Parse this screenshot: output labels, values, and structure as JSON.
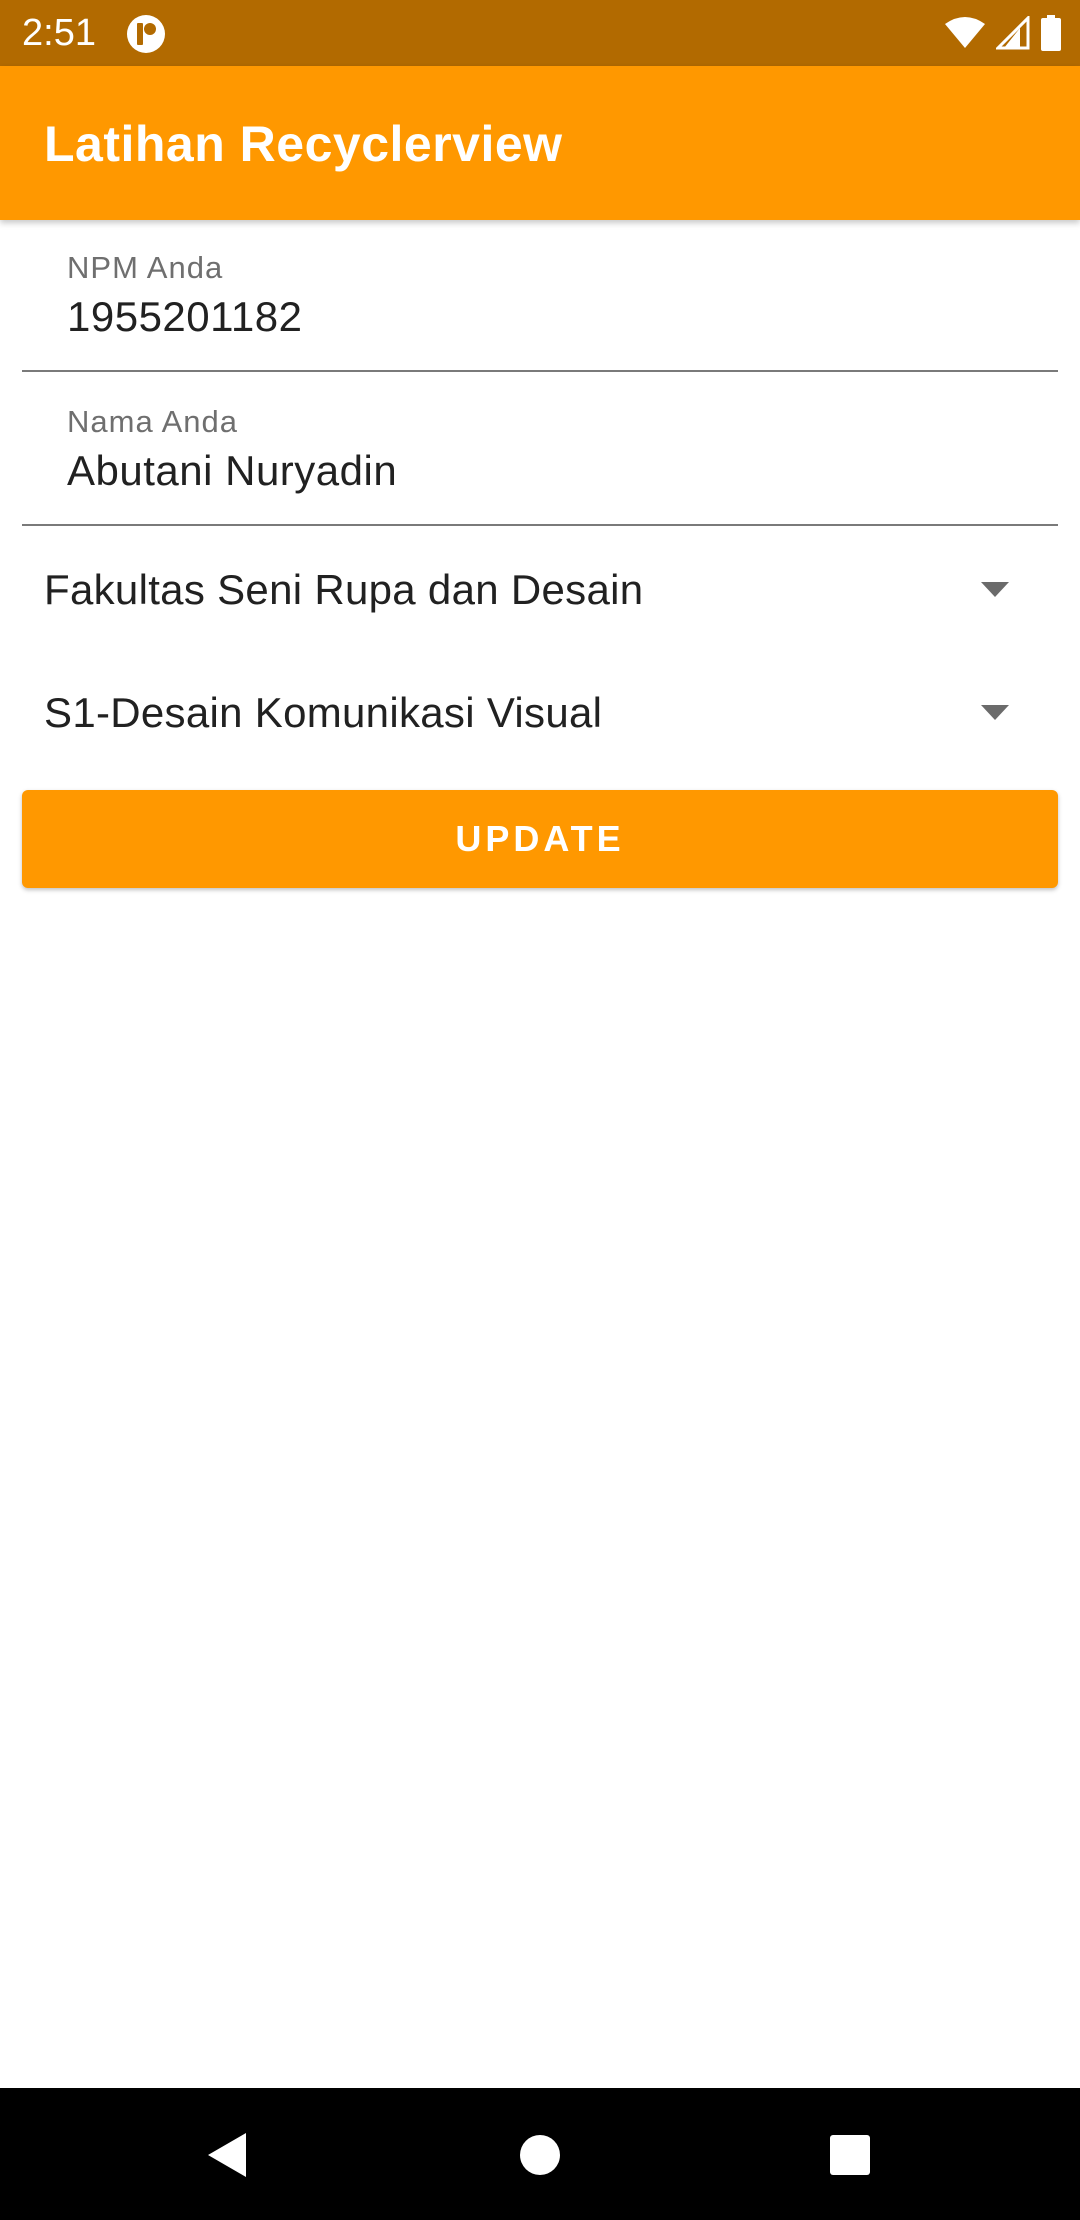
{
  "status_bar": {
    "time": "2:51",
    "icons": [
      "app-notification-icon",
      "wifi-icon",
      "signal-icon",
      "battery-icon"
    ],
    "background": "#b26a00"
  },
  "app_bar": {
    "title": "Latihan Recyclerview",
    "background": "#ff9800"
  },
  "form": {
    "npm": {
      "label": "NPM Anda",
      "value": "1955201182"
    },
    "nama": {
      "label": "Nama Anda",
      "value": "Abutani Nuryadin"
    },
    "fakultas": {
      "selected": "Fakultas Seni Rupa dan Desain",
      "icon": "dropdown-arrow-icon"
    },
    "prodi": {
      "selected": "S1-Desain Komunikasi Visual",
      "icon": "dropdown-arrow-icon"
    },
    "update_button": {
      "label": "UPDATE",
      "color": "#ff9800"
    }
  },
  "nav_bar": {
    "buttons": [
      "back-icon",
      "home-icon",
      "recents-icon"
    ]
  }
}
